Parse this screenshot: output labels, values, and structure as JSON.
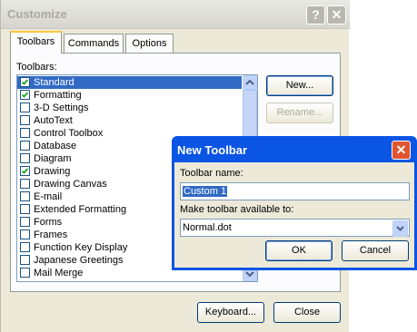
{
  "window": {
    "title": "Customize",
    "help_button": "?",
    "close_button": "✕"
  },
  "tabs": [
    {
      "label": "Toolbars",
      "active": true
    },
    {
      "label": "Commands",
      "active": false
    },
    {
      "label": "Options",
      "active": false
    }
  ],
  "toolbars_panel": {
    "list_label": "Toolbars:",
    "items": [
      {
        "label": "Standard",
        "checked": true,
        "selected": true
      },
      {
        "label": "Formatting",
        "checked": true,
        "selected": false
      },
      {
        "label": "3-D Settings",
        "checked": false,
        "selected": false
      },
      {
        "label": "AutoText",
        "checked": false,
        "selected": false
      },
      {
        "label": "Control Toolbox",
        "checked": false,
        "selected": false
      },
      {
        "label": "Database",
        "checked": false,
        "selected": false
      },
      {
        "label": "Diagram",
        "checked": false,
        "selected": false
      },
      {
        "label": "Drawing",
        "checked": true,
        "selected": false
      },
      {
        "label": "Drawing Canvas",
        "checked": false,
        "selected": false
      },
      {
        "label": "E-mail",
        "checked": false,
        "selected": false
      },
      {
        "label": "Extended Formatting",
        "checked": false,
        "selected": false
      },
      {
        "label": "Forms",
        "checked": false,
        "selected": false
      },
      {
        "label": "Frames",
        "checked": false,
        "selected": false
      },
      {
        "label": "Function Key Display",
        "checked": false,
        "selected": false
      },
      {
        "label": "Japanese Greetings",
        "checked": false,
        "selected": false
      },
      {
        "label": "Mail Merge",
        "checked": false,
        "selected": false
      }
    ],
    "new_button": "New...",
    "rename_button": "Rename..."
  },
  "footer": {
    "keyboard_button": "Keyboard...",
    "close_button": "Close"
  },
  "new_toolbar_dialog": {
    "title": "New Toolbar",
    "close_button": "✕",
    "name_label": "Toolbar name:",
    "name_value": "Custom 1",
    "available_label": "Make toolbar available to:",
    "available_value": "Normal.dot",
    "ok_button": "OK",
    "cancel_button": "Cancel"
  }
}
